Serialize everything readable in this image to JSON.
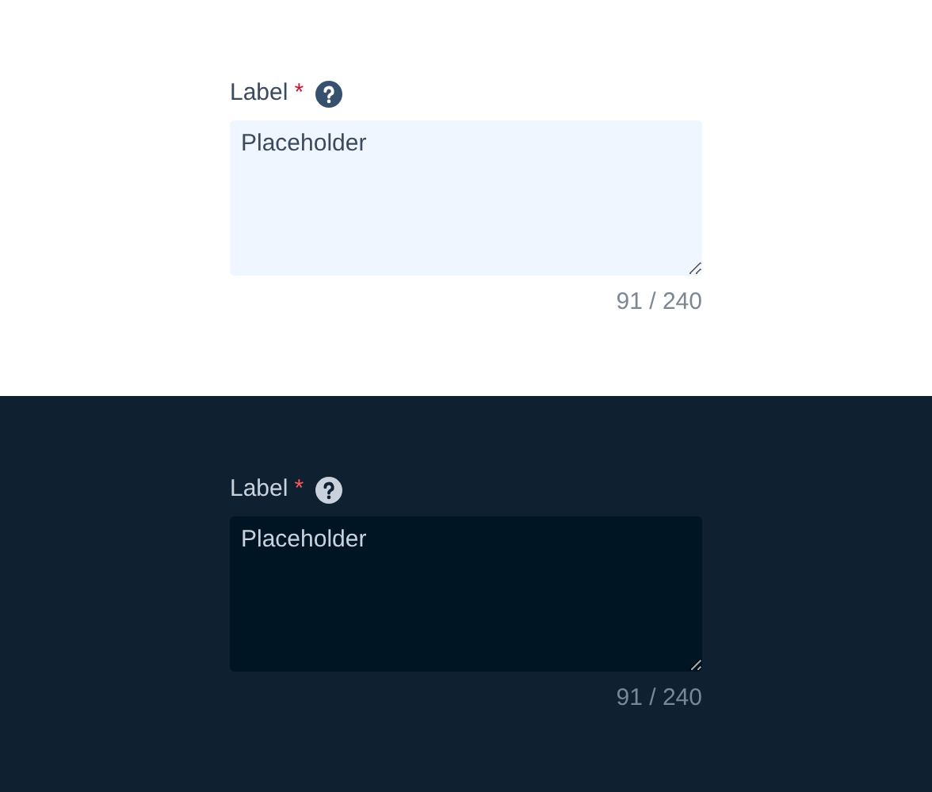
{
  "panels": [
    {
      "kind": "light",
      "label": "Label",
      "required_mark": "*",
      "placeholder": "Placeholder",
      "counter": "91 / 240"
    },
    {
      "kind": "dark",
      "label": "Label",
      "required_mark": "*",
      "placeholder": "Placeholder",
      "counter": "91 / 240"
    }
  ]
}
